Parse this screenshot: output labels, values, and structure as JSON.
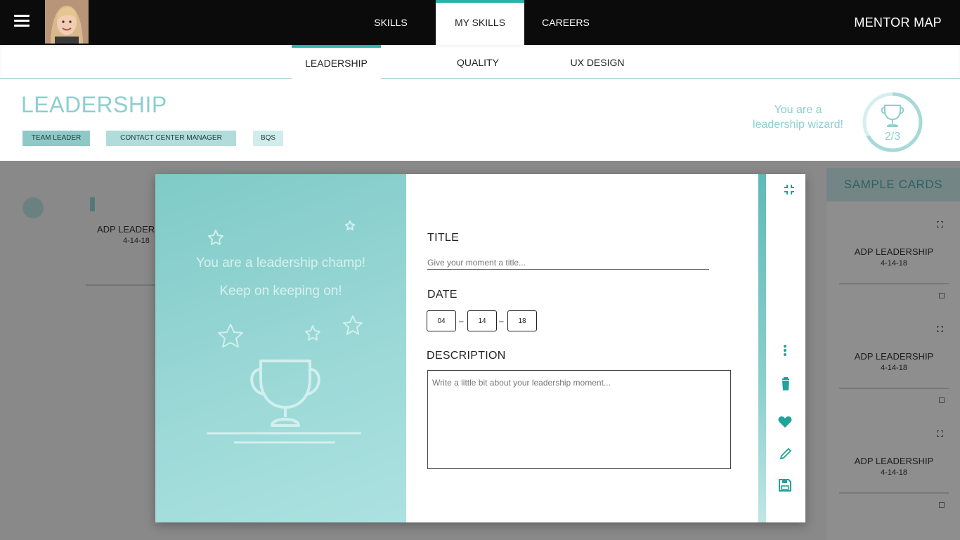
{
  "nav": {
    "items": [
      {
        "label": "SKILLS"
      },
      {
        "label": "MY SKILLS",
        "active": true
      },
      {
        "label": "CAREERS"
      }
    ],
    "brand": "MENTOR MAP"
  },
  "subtabs": [
    {
      "label": "LEADERSHIP",
      "active": true
    },
    {
      "label": "QUALITY"
    },
    {
      "label": "UX DESIGN"
    }
  ],
  "skill": {
    "title": "LEADERSHIP",
    "chips": [
      "TEAM LEADER",
      "CONTACT CENTER MANAGER",
      "BQS"
    ],
    "wizard_line1": "You are a",
    "wizard_line2": "leadership wizard!",
    "progress_label": "2/3",
    "progress_fraction": 0.667
  },
  "background": {
    "card_title": "ADP LEADERS",
    "card_date": "4-14-18",
    "samples_title": "SAMPLE  CARDS",
    "sample_cards": [
      {
        "title": "ADP LEADERSHIP",
        "date": "4-14-18"
      },
      {
        "title": "ADP LEADERSHIP",
        "date": "4-14-18"
      },
      {
        "title": "ADP LEADERSHIP",
        "date": "4-14-18"
      }
    ]
  },
  "modal": {
    "champ_line1": "You are a leadership champ!",
    "champ_line2": "Keep on keeping on!",
    "title_label": "TITLE",
    "title_placeholder": "Give your moment a title...",
    "date_label": "DATE",
    "date_month": "04",
    "date_day": "14",
    "date_year": "18",
    "date_sep": "–",
    "description_label": "DESCRIPTION",
    "description_placeholder": "Write a little bit about your leadership moment..."
  },
  "icons": {
    "menu": "hamburger-icon",
    "collapse": "collapse-icon",
    "more": "more-vert-icon",
    "delete": "trash-icon",
    "favorite": "heart-icon",
    "edit": "pencil-icon",
    "save": "save-icon",
    "trophy": "trophy-icon"
  },
  "colors": {
    "accent": "#2ab3a8",
    "teal_light": "#8ccfcf",
    "teal_icon": "#1fa39a",
    "topbar": "#0b0b0b"
  }
}
